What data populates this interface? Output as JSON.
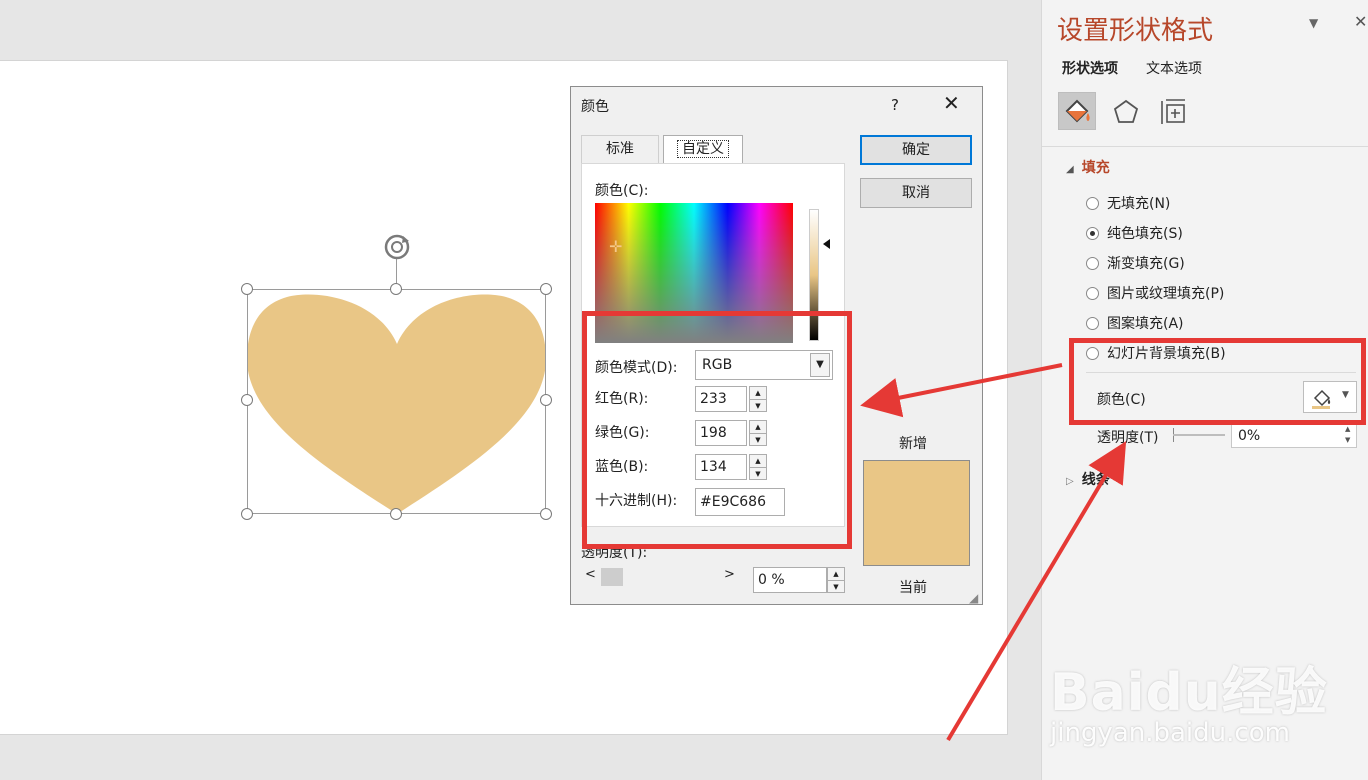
{
  "dialog": {
    "title": "颜色",
    "help": "?",
    "close": "✕",
    "tabs": [
      "标准",
      "自定义"
    ],
    "color_label": "颜色(C):",
    "mode_label": "颜色模式(D):",
    "mode_value": "RGB",
    "red_label": "红色(R):",
    "red_value": "233",
    "green_label": "绿色(G):",
    "green_value": "198",
    "blue_label": "蓝色(B):",
    "blue_value": "134",
    "hex_label": "十六进制(H):",
    "hex_value": "#E9C686",
    "ok": "确定",
    "cancel": "取消",
    "new_label": "新增",
    "current_label": "当前",
    "transparency_label": "透明度(T):",
    "transparency_value": "0 %"
  },
  "pane": {
    "title": "设置形状格式",
    "tabs": [
      "形状选项",
      "文本选项"
    ],
    "fill_header": "填充",
    "fill_options": [
      {
        "label": "无填充(N)",
        "selected": false
      },
      {
        "label": "纯色填充(S)",
        "selected": true
      },
      {
        "label": "渐变填充(G)",
        "selected": false
      },
      {
        "label": "图片或纹理填充(P)",
        "selected": false
      },
      {
        "label": "图案填充(A)",
        "selected": false
      },
      {
        "label": "幻灯片背景填充(B)",
        "selected": false
      }
    ],
    "color_label": "颜色(C)",
    "transparency_label": "透明度(T)",
    "transparency_value": "0%",
    "line_header": "线条"
  },
  "watermark": {
    "logo_text": "Baidu经验",
    "url": "jingyan.baidu.com"
  },
  "colors": {
    "heart_fill": "#E9C686",
    "accent": "#b7472a",
    "highlight": "#e53935"
  }
}
